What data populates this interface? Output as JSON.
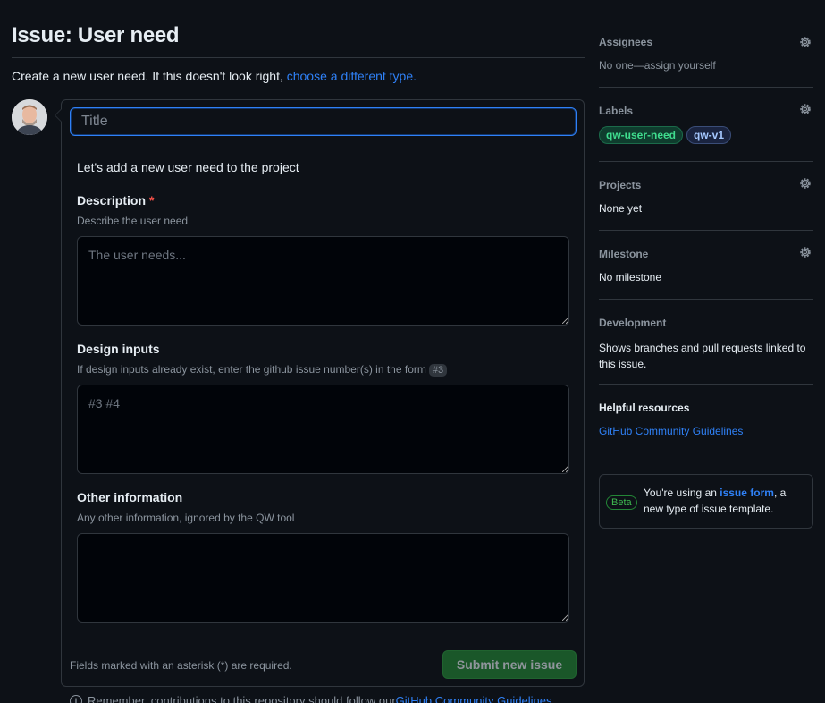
{
  "page": {
    "title": "Issue: User need",
    "subtitle_text": "Create a new user need. If this doesn't look right, ",
    "subtitle_link": "choose a different type."
  },
  "form": {
    "title_placeholder": "Title",
    "intro": "Let's add a new user need to the project",
    "fields": [
      {
        "label": "Description",
        "required": "*",
        "description": "Describe the user need",
        "placeholder": "The user needs..."
      },
      {
        "label": "Design inputs",
        "description": "If design inputs already exist, enter the github issue number(s) in the form",
        "badge": "#3",
        "placeholder": "#3 #4"
      },
      {
        "label": "Other information",
        "description": "Any other information, ignored by the QW tool",
        "placeholder": ""
      }
    ],
    "required_note": "Fields marked with an asterisk (*) are required.",
    "submit_label": "Submit new issue",
    "remember_text": "Remember, contributions to this repository should follow our ",
    "remember_link": "GitHub Community Guidelines"
  },
  "sidebar": {
    "assignees": {
      "heading": "Assignees",
      "value": "No one—",
      "action": "assign yourself"
    },
    "labels": {
      "heading": "Labels",
      "items": [
        "qw-user-need",
        "qw-v1"
      ]
    },
    "projects": {
      "heading": "Projects",
      "value": "None yet"
    },
    "milestone": {
      "heading": "Milestone",
      "value": "No milestone"
    },
    "development": {
      "heading": "Development",
      "value": "Shows branches and pull requests linked to this issue."
    },
    "helpful": {
      "heading": "Helpful resources",
      "link": "GitHub Community Guidelines"
    },
    "beta": {
      "badge": "Beta",
      "text_before": "You're using an ",
      "link": "issue form",
      "text_after": ", a new type of issue template."
    }
  },
  "colors": {
    "accent": "#2f81f7",
    "success": "#238636",
    "danger": "#f85149",
    "background": "#0d1117"
  }
}
